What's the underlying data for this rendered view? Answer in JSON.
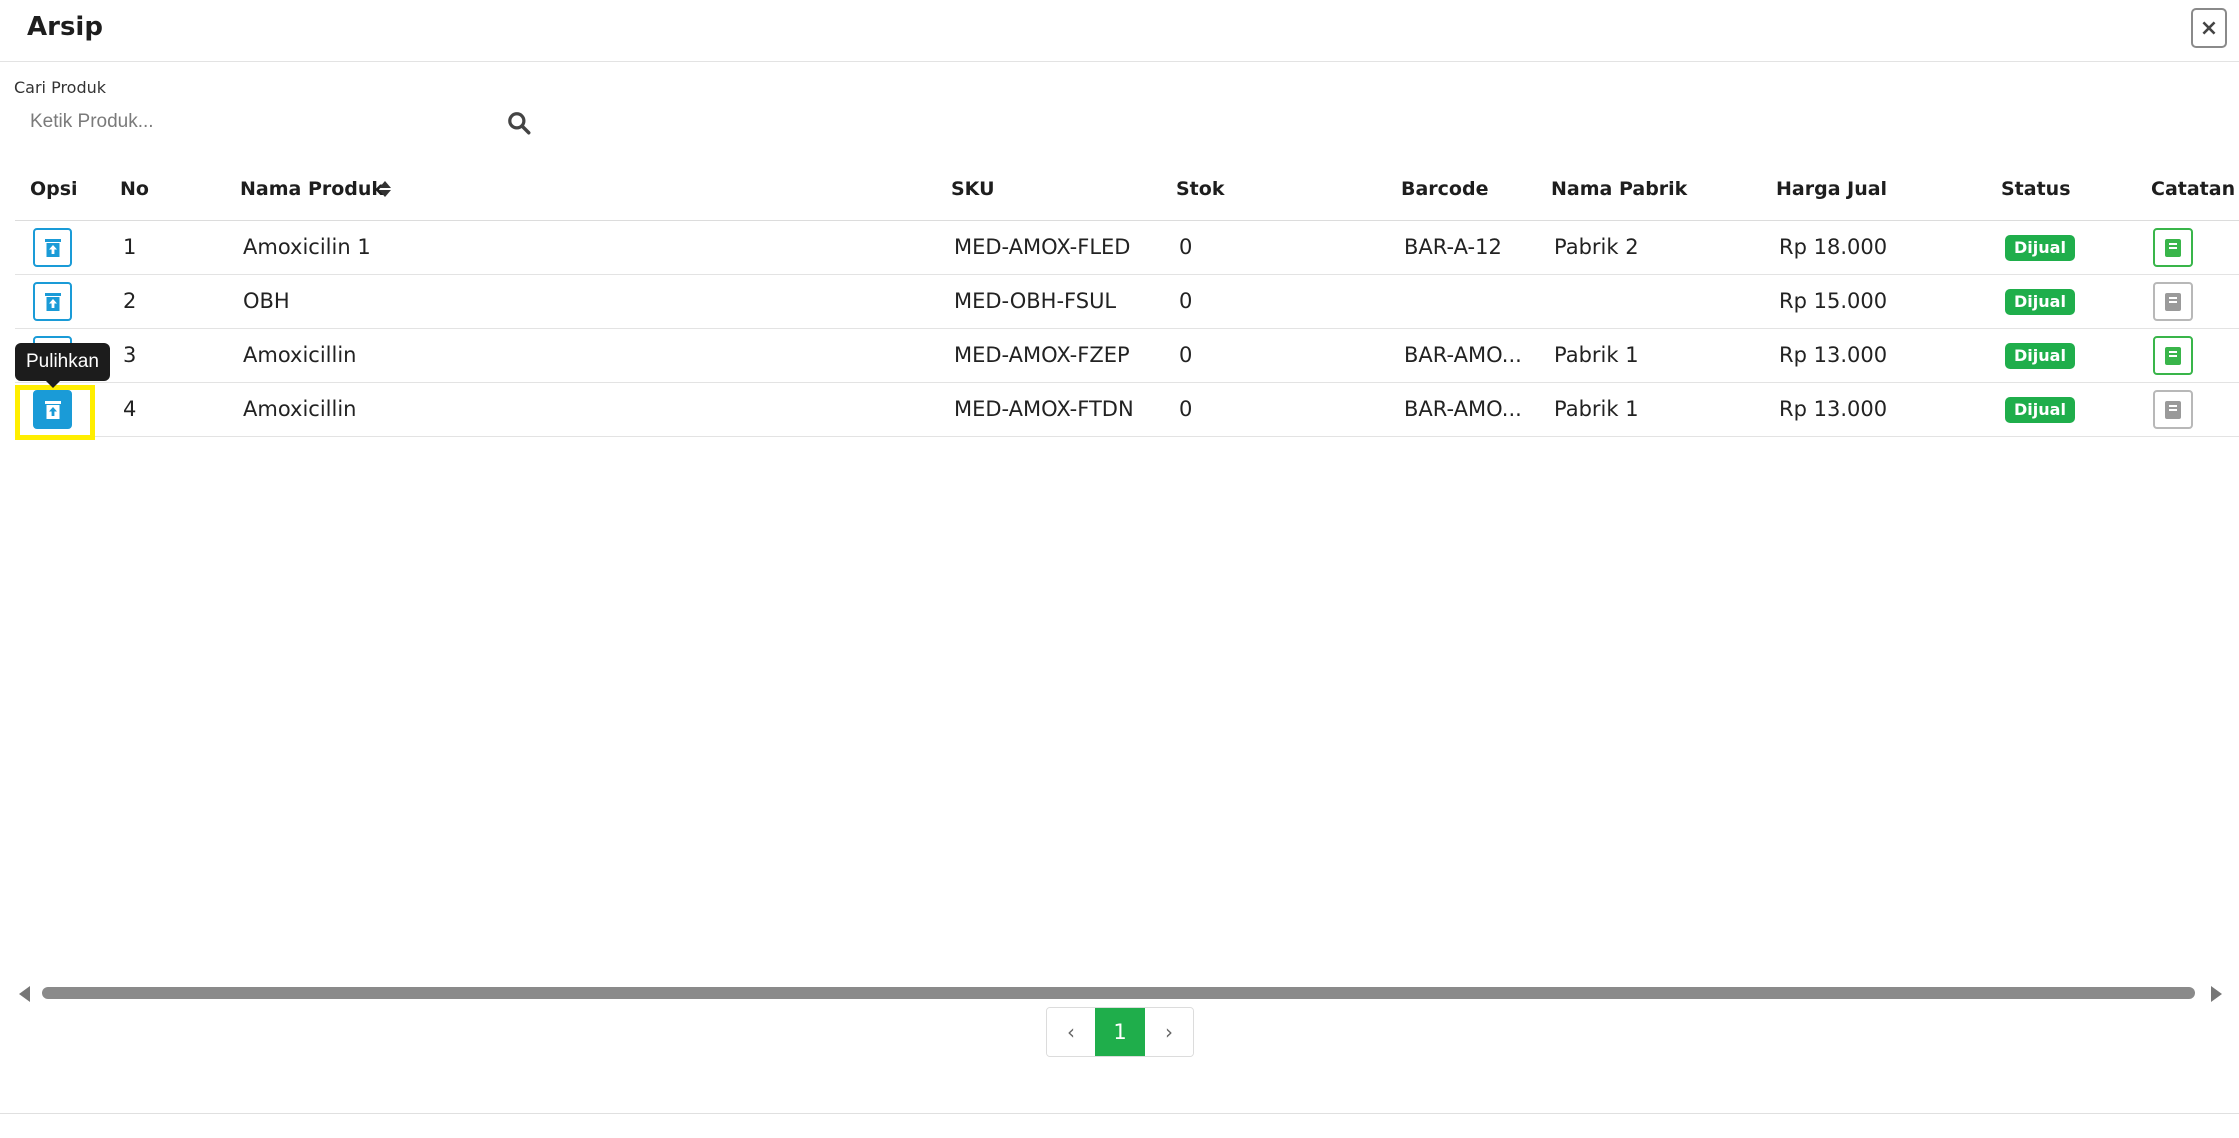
{
  "modal": {
    "title": "Arsip",
    "close_label": "×"
  },
  "search": {
    "label": "Cari Produk",
    "placeholder": "Ketik Produk..."
  },
  "table": {
    "headers": {
      "opsi": "Opsi",
      "no": "No",
      "nama_produk": "Nama Produk",
      "sku": "SKU",
      "stok": "Stok",
      "barcode": "Barcode",
      "nama_pabrik": "Nama Pabrik",
      "harga_jual": "Harga Jual",
      "status": "Status",
      "catatan": "Catatan"
    },
    "rows": [
      {
        "no": "1",
        "nama_produk": "Amoxicilin 1",
        "sku": "MED-AMOX-FLED",
        "stok": "0",
        "barcode": "BAR-A-12",
        "nama_pabrik": "Pabrik 2",
        "harga_jual": "Rp 18.000",
        "status": "Dijual",
        "has_note": true
      },
      {
        "no": "2",
        "nama_produk": "OBH",
        "sku": "MED-OBH-FSUL",
        "stok": "0",
        "barcode": "",
        "nama_pabrik": "",
        "harga_jual": "Rp 15.000",
        "status": "Dijual",
        "has_note": false
      },
      {
        "no": "3",
        "nama_produk": "Amoxicillin",
        "sku": "MED-AMOX-FZEP",
        "stok": "0",
        "barcode": "BAR-AMO...",
        "nama_pabrik": "Pabrik 1",
        "harga_jual": "Rp 13.000",
        "status": "Dijual",
        "has_note": true
      },
      {
        "no": "4",
        "nama_produk": "Amoxicillin",
        "sku": "MED-AMOX-FTDN",
        "stok": "0",
        "barcode": "BAR-AMO...",
        "nama_pabrik": "Pabrik 1",
        "harga_jual": "Rp 13.000",
        "status": "Dijual",
        "has_note": false
      }
    ]
  },
  "tooltip": {
    "text": "Pulihkan"
  },
  "pagination": {
    "prev": "‹",
    "current": "1",
    "next": "›"
  },
  "colors": {
    "primary_blue": "#1a9bd7",
    "success_green": "#1fae4b",
    "highlight_yellow": "#ffee00"
  },
  "icons": {
    "restore": "restore-icon",
    "note": "note-icon",
    "search": "search-icon",
    "close": "close-icon",
    "sort": "sort-icon"
  }
}
